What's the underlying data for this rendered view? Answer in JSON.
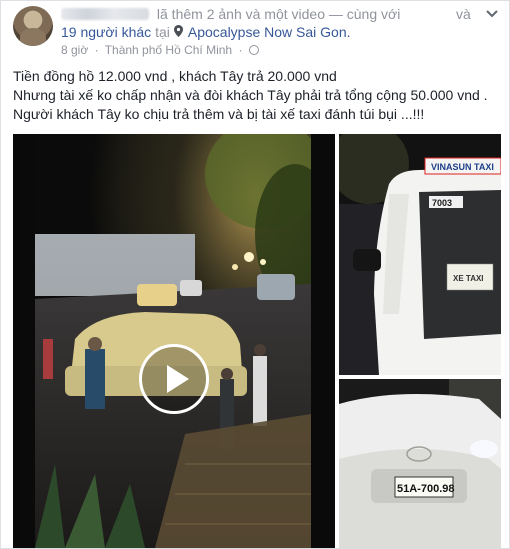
{
  "post": {
    "header": {
      "prefix_hidden": "",
      "action_text": "lã thêm 2 ảnh và một video — cùng với",
      "trailing": "và",
      "others_text": "19 người khác",
      "at_text": "tại",
      "place_name": "Apocalypse Now Sai Gon."
    },
    "meta": {
      "time": "8 giờ",
      "separator": "·",
      "city": "Thành phố Hồ Chí Minh",
      "privacy_separator": "·"
    },
    "body": {
      "line1": "Tiền đồng hồ 12.000 vnd , khách Tây trả 20.000 vnd",
      "line2": "Nhưng tài xế ko chấp nhận và đòi khách Tây phải trả tổng cộng 50.000 vnd .",
      "line3": "Người khách Tây ko chịu trả thêm và bị tài xế taxi đánh túi bụi ...!!!"
    },
    "photos": {
      "taxi_brand": "VINASUN TAXI",
      "taxi_number": "7003",
      "taxi_sign": "XE TAXI",
      "plate": "51A-700.98"
    }
  },
  "colors": {
    "link": "#365899",
    "muted": "#90949c",
    "text": "#1d2129"
  }
}
